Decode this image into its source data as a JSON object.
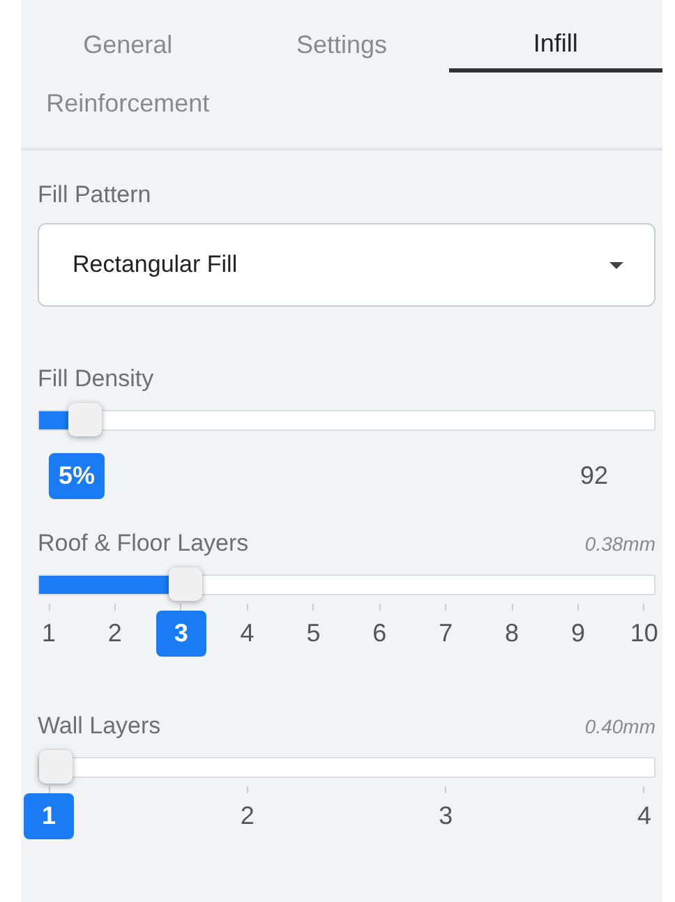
{
  "tabs": [
    {
      "label": "General",
      "selected": false
    },
    {
      "label": "Settings",
      "selected": false
    },
    {
      "label": "Infill",
      "selected": true
    },
    {
      "label": "Reinforcement",
      "selected": false
    }
  ],
  "fields": [
    {
      "kind": "dropdown",
      "label": "Fill Pattern",
      "value": "Rectangular Fill"
    },
    {
      "kind": "slider",
      "label": "Fill Density",
      "level": 0.05,
      "value": "5%",
      "max": "92"
    },
    {
      "kind": "steps",
      "label": "Roof & Floor Layers",
      "hint": "0.38mm",
      "level": 0.222,
      "steps": [
        {
          "label": "1",
          "selected": false
        },
        {
          "label": "2",
          "selected": false
        },
        {
          "label": "3",
          "selected": true
        },
        {
          "label": "4",
          "selected": false
        },
        {
          "label": "5",
          "selected": false
        },
        {
          "label": "6",
          "selected": false
        },
        {
          "label": "7",
          "selected": false
        },
        {
          "label": "8",
          "selected": false
        },
        {
          "label": "9",
          "selected": false
        },
        {
          "label": "10",
          "selected": false
        }
      ]
    },
    {
      "kind": "steps",
      "label": "Wall Layers",
      "hint": "0.40mm",
      "level": 0,
      "steps": [
        {
          "label": "1",
          "selected": true
        },
        {
          "label": "2",
          "selected": false
        },
        {
          "label": "3",
          "selected": false
        },
        {
          "label": "4",
          "selected": false
        }
      ]
    }
  ]
}
